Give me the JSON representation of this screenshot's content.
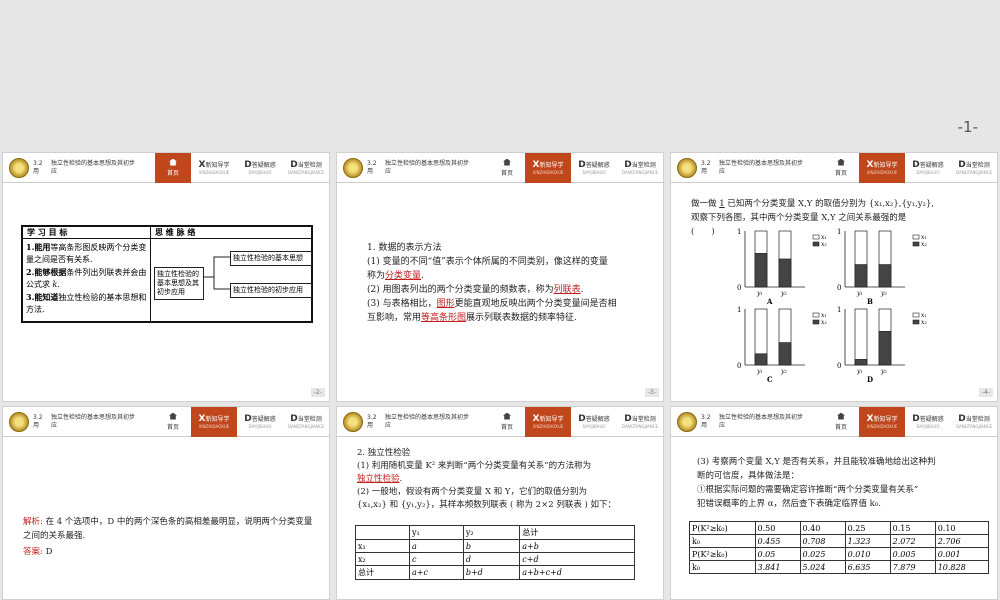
{
  "top": {
    "page_num": "-1-"
  },
  "header": {
    "section_no": "3.2",
    "section_suffix": "用",
    "title": "独立性检验的基本思想及其初步应",
    "home": "首页",
    "nav1_big": "X",
    "nav1_label": "新知导学",
    "nav1_sub": "XINZHIDAOXUE",
    "nav2_big": "D",
    "nav2_label": "答疑解惑",
    "nav2_sub": "DAYIJIEHUO",
    "nav3_big": "D",
    "nav3_label": "当堂检测",
    "nav3_sub": "DANGTANGJIANCE"
  },
  "slide1": {
    "col1": "学 习 目 标",
    "col2": "思 维 脉 络",
    "goal1_a": "1.能用",
    "goal1_b": "等高条形图反映两个分类变量之间是否有关系.",
    "goal2_a": "2.能够根据",
    "goal2_b": "条件列出列联表并会由公式求",
    "goal2_k": "k.",
    "goal3_a": "3.能知道",
    "goal3_b": "独立性检验的基本思想和方法.",
    "mind_center": "独立性检验的基本思想及其初步应用",
    "mind_a": "独立性检验的基本思想",
    "mind_b": "独立性检验的初步应用",
    "num": "-2-"
  },
  "slide2": {
    "h": "1. 数据的表示方法",
    "p1": "(1) 变量的不同“值”表示个体所属的不同类别，像这样的变量",
    "p1_blank": "分类变量",
    "p2": "(2) 用图表列出的两个分类变量的频数表，称为",
    "p2_blank": "列联表",
    "p3": "(3) 与表格相比，",
    "p3_blank": "图形",
    "p3b": "更能直观地反映出两个分类变量间是否相",
    "p4": "互影响，常用",
    "p4_blank": "等高条形图",
    "p4b": "展示列联表数据的频率特征.",
    "num": "-3-"
  },
  "slide3": {
    "q1": "做一做",
    "q1_num": "1",
    "q1_text": "已知两个分类变量 X,Y 的取值分别为 {x₁,x₂},{y₁,y₂},",
    "q2": "观察下列各图，其中两个分类变量 X,Y 之间关系最强的是",
    "q3": "(　　)",
    "legend1": "x₁",
    "legend2": "x₂",
    "labels": [
      "A",
      "B",
      "C",
      "D"
    ],
    "y1": "y₁",
    "y2": "y₂",
    "tick1": "1",
    "tick0": "0",
    "num": "-4-"
  },
  "chart_data": [
    {
      "type": "bar",
      "title": "A",
      "categories": [
        "y₁",
        "y₂"
      ],
      "series": [
        {
          "name": "x₂",
          "values": [
            0.6,
            0.5
          ]
        }
      ],
      "ylim": [
        0,
        1
      ]
    },
    {
      "type": "bar",
      "title": "B",
      "categories": [
        "y₁",
        "y₂"
      ],
      "series": [
        {
          "name": "x₂",
          "values": [
            0.4,
            0.4
          ]
        }
      ],
      "ylim": [
        0,
        1
      ]
    },
    {
      "type": "bar",
      "title": "C",
      "categories": [
        "y₁",
        "y₂"
      ],
      "series": [
        {
          "name": "x₂",
          "values": [
            0.2,
            0.4
          ]
        }
      ],
      "ylim": [
        0,
        1
      ]
    },
    {
      "type": "bar",
      "title": "D",
      "categories": [
        "y₁",
        "y₂"
      ],
      "series": [
        {
          "name": "x₂",
          "values": [
            0.1,
            0.6
          ]
        }
      ],
      "ylim": [
        0,
        1
      ]
    }
  ],
  "slide4": {
    "a_label": "解析:",
    "a_text": "在 4 个选项中，D 中的两个深色条的高相差最明显，说明两个分类变量之间的关系最强.",
    "ans_label": "答案:",
    "ans": "D"
  },
  "slide5": {
    "h": "2. 独立性检验",
    "p1": "(1) 利用随机变量 K² 来判断“两个分类变量有关系”的方法称为",
    "p1_blank": "独立性检验",
    "p2": "(2) 一般地，假设有两个分类变量 X 和 Y，它们的取值分别为",
    "p3": "{x₁,x₂} 和 {y₁,y₂}，其样本频数列联表 ( 称为 2×2 列联表 ) 如下：",
    "table": [
      [
        "",
        "y₁",
        "y₂",
        "总计"
      ],
      [
        "x₁",
        "a",
        "b",
        "a+b"
      ],
      [
        "x₂",
        "c",
        "d",
        "c+d"
      ],
      [
        "总计",
        "a+c",
        "b+d",
        "a+b+c+d"
      ]
    ]
  },
  "slide6": {
    "p1": "(3) 考察两个变量 X,Y 是否有关系，并且能较准确地给出这种判",
    "p2": "断的可信度，具体做法是：",
    "p3": "①根据实际问题的需要确定容许推断“两个分类变量有关系”",
    "p4": "犯错误概率的上界 α，然后查下表确定临界值 k₀.",
    "table": [
      [
        "P(K²≥k₀)",
        "0.50",
        "0.40",
        "0.25",
        "0.15",
        "0.10"
      ],
      [
        "k₀",
        "0.455",
        "0.708",
        "1.323",
        "2.072",
        "2.706"
      ],
      [
        "P(K²≥k₀)",
        "0.05",
        "0.025",
        "0.010",
        "0.005",
        "0.001"
      ],
      [
        "k₀",
        "3.841",
        "5.024",
        "6.635",
        "7.879",
        "10.828"
      ]
    ]
  }
}
